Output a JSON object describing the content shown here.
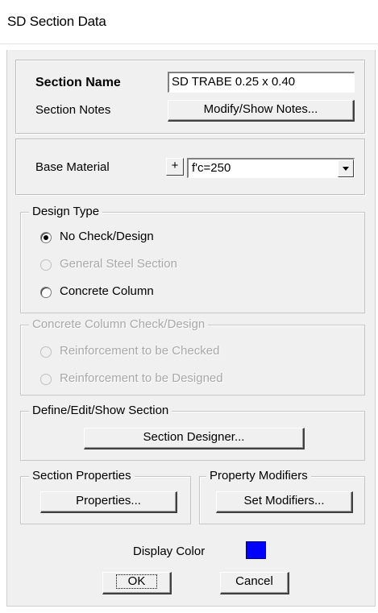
{
  "window": {
    "title": "SD Section Data"
  },
  "name_panel": {
    "section_name_label": "Section Name",
    "section_name_value": "SD TRABE 0.25 x 0.40",
    "section_notes_label": "Section Notes",
    "notes_button": "Modify/Show Notes..."
  },
  "material_panel": {
    "base_material_label": "Base Material",
    "plus_button": "+",
    "material_value": "f'c=250"
  },
  "design_type": {
    "legend": "Design Type",
    "options": [
      {
        "label": "No Check/Design",
        "checked": true,
        "enabled": true
      },
      {
        "label": "General Steel Section",
        "checked": false,
        "enabled": false
      },
      {
        "label": "Concrete Column",
        "checked": false,
        "enabled": true
      }
    ]
  },
  "concrete_column": {
    "legend": "Concrete Column Check/Design",
    "options": [
      {
        "label": "Reinforcement to be Checked",
        "enabled": false
      },
      {
        "label": "Reinforcement to be Designed",
        "enabled": false
      }
    ]
  },
  "define_section": {
    "legend": "Define/Edit/Show Section",
    "button": "Section Designer..."
  },
  "section_properties": {
    "legend": "Section Properties",
    "button": "Properties..."
  },
  "property_modifiers": {
    "legend": "Property Modifiers",
    "button": "Set Modifiers..."
  },
  "display_color": {
    "label": "Display Color",
    "color": "#0000ff"
  },
  "footer": {
    "ok_button": "OK",
    "cancel_button": "Cancel"
  }
}
